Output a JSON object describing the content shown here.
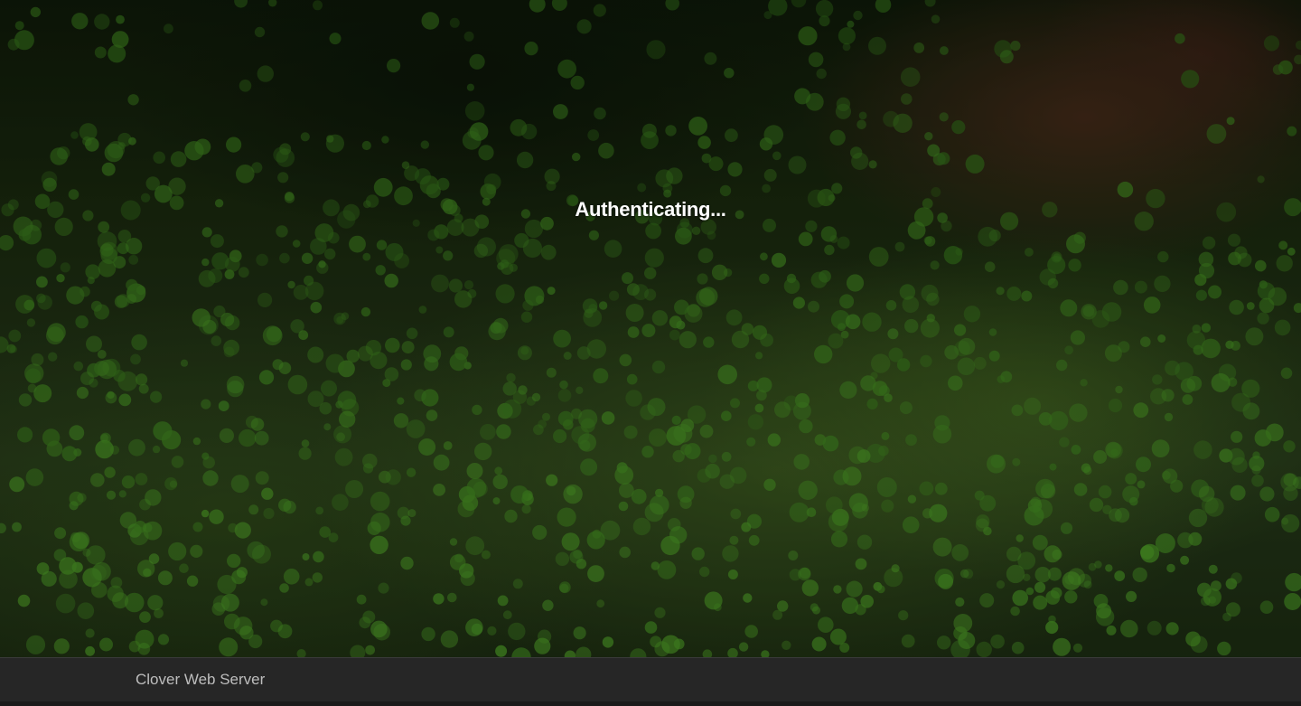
{
  "background": {
    "image": "clover-groundcover-photo",
    "colors": {
      "leaf": "#5a8a2a",
      "bark": "#4a2c1c",
      "shade": "#0f1a09"
    }
  },
  "status": {
    "text": "Authenticating..."
  },
  "footer": {
    "label": "Clover Web Server",
    "color": "#262626"
  }
}
